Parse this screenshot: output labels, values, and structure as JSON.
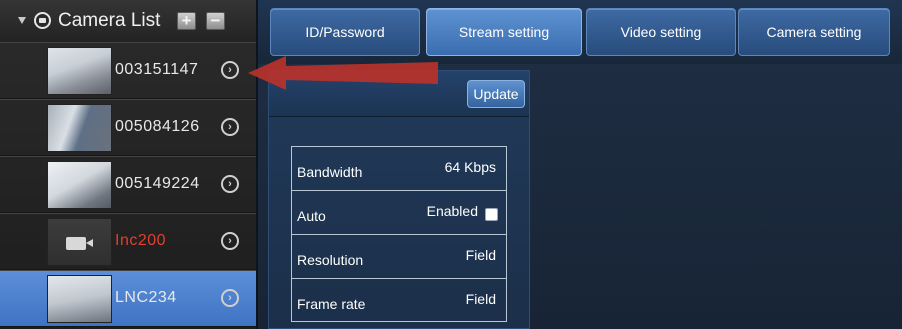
{
  "camera_panel": {
    "title": "Camera List",
    "add_label": "+",
    "remove_label": "−",
    "cameras": [
      {
        "name": "003151147",
        "thumbnail": "office-photo",
        "status": "normal"
      },
      {
        "name": "005084126",
        "thumbnail": "office-photo",
        "status": "normal"
      },
      {
        "name": "005149224",
        "thumbnail": "office-photo",
        "status": "normal"
      },
      {
        "name": "Inc200",
        "thumbnail": "camera-icon",
        "status": "error"
      },
      {
        "name": "LNC234",
        "thumbnail": "office-photo",
        "status": "selected"
      }
    ],
    "chevron_glyph": "›"
  },
  "tabs": [
    {
      "label": "ID/Password",
      "active": false
    },
    {
      "label": "Stream setting",
      "active": true
    },
    {
      "label": "Video setting",
      "active": false
    },
    {
      "label": "Camera setting",
      "active": false
    }
  ],
  "stream_settings": {
    "update_label": "Update",
    "rows": [
      {
        "label": "Bandwidth",
        "value": "64 Kbps"
      },
      {
        "label": "Auto",
        "value": "Enabled",
        "checked": false
      },
      {
        "label": "Resolution",
        "value": "Field"
      },
      {
        "label": "Frame rate",
        "value": "Field"
      }
    ]
  },
  "colors": {
    "selected_row": "#4a7fcc",
    "error_text": "#e0402e",
    "annotation_arrow": "#b8322a"
  }
}
